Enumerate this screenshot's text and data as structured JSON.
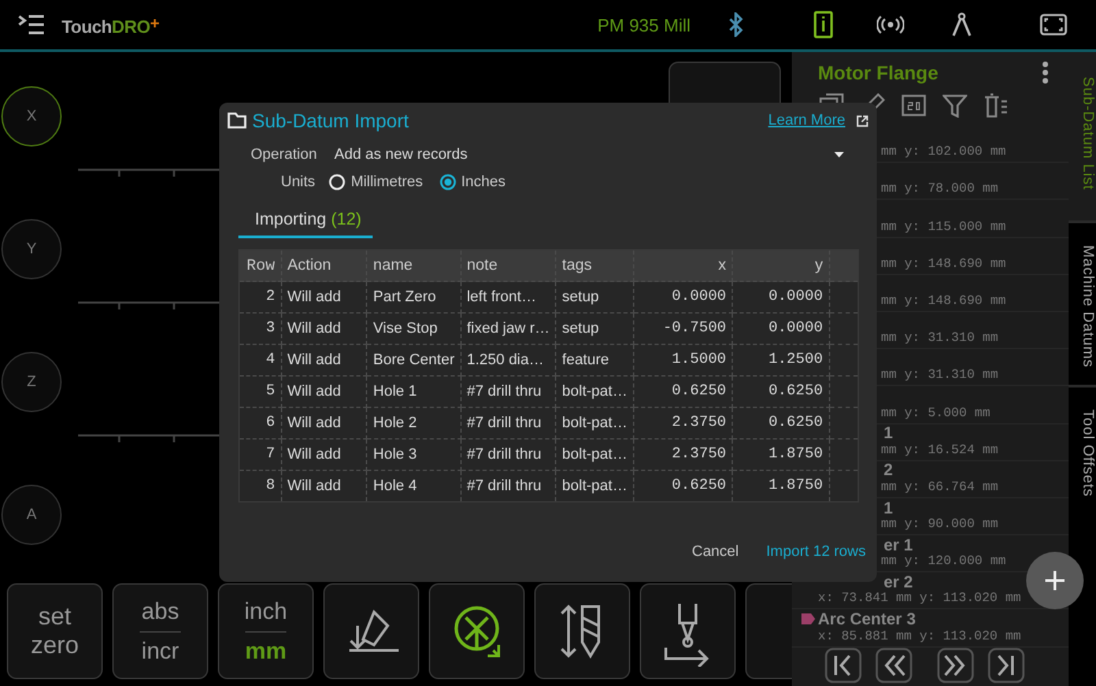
{
  "top_bar": {
    "logo": {
      "word": "Touch",
      "accent": "DRO",
      "mark": "+"
    },
    "machine": "PM 935 Mill"
  },
  "axes": [
    {
      "label": "X",
      "selected": true
    },
    {
      "label": "Y",
      "selected": false
    },
    {
      "label": "Z",
      "selected": false
    },
    {
      "label": "A",
      "selected": false
    }
  ],
  "bottom_buttons": [
    {
      "kind": "text",
      "lines": [
        "set",
        "zero"
      ]
    },
    {
      "kind": "toggle",
      "options": [
        {
          "label": "abs",
          "selected": false
        },
        {
          "label": "incr",
          "selected": false
        }
      ]
    },
    {
      "kind": "toggle",
      "options": [
        {
          "label": "inch",
          "selected": false
        },
        {
          "label": "mm",
          "selected": true
        }
      ]
    },
    {
      "kind": "icon",
      "active": false
    },
    {
      "kind": "icon",
      "active": true
    },
    {
      "kind": "icon",
      "active": false
    },
    {
      "kind": "icon",
      "active": false
    },
    {
      "kind": "blank"
    }
  ],
  "panel": {
    "title": "Motor Flange",
    "items": [
      {
        "coords": "mm y: 102.000 mm"
      },
      {
        "coords": "mm y: 78.000 mm"
      },
      {
        "coords": "mm y: 115.000 mm"
      },
      {
        "coords": "mm y: 148.690 mm"
      },
      {
        "coords": "mm y: 148.690 mm"
      },
      {
        "coords": "mm y: 31.310 mm"
      },
      {
        "coords": "mm y: 31.310 mm"
      },
      {
        "coords": "mm y: 5.000 mm"
      },
      {
        "title": "1",
        "coords": "mm y: 16.524 mm"
      },
      {
        "title": "2",
        "coords": "mm y: 66.764 mm"
      },
      {
        "title": "1",
        "coords": "mm y: 90.000 mm"
      },
      {
        "title": "er 1",
        "coords": "mm y: 120.000 mm"
      },
      {
        "title": "er 2",
        "coords": "x: 73.841 mm y: 113.020 mm"
      },
      {
        "title": "Arc Center 3",
        "coords": "x: 85.881 mm y: 113.020 mm",
        "color": "#9c3f68"
      }
    ]
  },
  "side_tabs": [
    {
      "label": "Sub-Datum List",
      "selected": true
    },
    {
      "label": "Machine Datums",
      "selected": false
    },
    {
      "label": "Tool Offsets",
      "selected": false
    }
  ],
  "dialog": {
    "title": "Sub-Datum Import",
    "learn_more": "Learn More",
    "operation": {
      "label": "Operation",
      "value": "Add as new records"
    },
    "units": {
      "label": "Units",
      "options": [
        {
          "label": "Millimetres",
          "selected": false
        },
        {
          "label": "Inches",
          "selected": true
        }
      ]
    },
    "tab": {
      "label": "Importing",
      "count": "(12)",
      "selected": true
    },
    "table": {
      "columns": [
        "Row",
        "Action",
        "name",
        "note",
        "tags",
        "x",
        "y"
      ],
      "rows": [
        [
          "2",
          "Will add",
          "Part Zero",
          "left front…",
          "setup",
          "0.0000",
          "0.0000"
        ],
        [
          "3",
          "Will add",
          "Vise Stop",
          "fixed jaw r…",
          "setup",
          "-0.7500",
          "0.0000"
        ],
        [
          "4",
          "Will add",
          "Bore Center",
          "1.250 dia…",
          "feature",
          "1.5000",
          "1.2500"
        ],
        [
          "5",
          "Will add",
          "Hole 1",
          "#7 drill thru",
          "bolt-pat…",
          "0.6250",
          "0.6250"
        ],
        [
          "6",
          "Will add",
          "Hole 2",
          "#7 drill thru",
          "bolt-pat…",
          "2.3750",
          "0.6250"
        ],
        [
          "7",
          "Will add",
          "Hole 3",
          "#7 drill thru",
          "bolt-pat…",
          "2.3750",
          "1.8750"
        ],
        [
          "8",
          "Will add",
          "Hole 4",
          "#7 drill thru",
          "bolt-pat…",
          "0.6250",
          "1.8750"
        ]
      ]
    },
    "buttons": [
      {
        "label": "Cancel",
        "kind": "plain"
      },
      {
        "label": "Import 12 rows",
        "kind": "primary"
      }
    ]
  }
}
